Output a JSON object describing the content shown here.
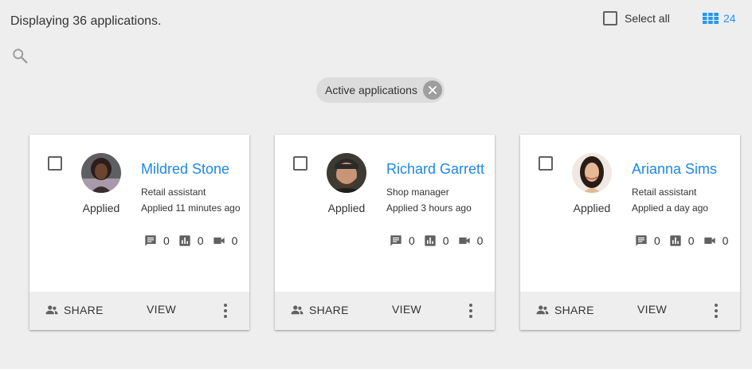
{
  "header": {
    "count_text": "Displaying 36 applications.",
    "select_all_label": "Select all",
    "view_count": "24"
  },
  "filter_chip": {
    "label": "Active applications"
  },
  "colors": {
    "accent": "#1e88e5",
    "background": "#eeeeee",
    "chip": "#dcdcdc"
  },
  "cards": [
    {
      "name": "Mildred Stone",
      "status": "Applied",
      "role": "Retail assistant",
      "applied_time": "Applied 11 minutes ago",
      "stats": {
        "comments": "0",
        "assessments": "0",
        "videos": "0"
      },
      "actions": {
        "share": "SHARE",
        "view": "VIEW"
      }
    },
    {
      "name": "Richard Garrett",
      "status": "Applied",
      "role": "Shop manager",
      "applied_time": "Applied 3 hours ago",
      "stats": {
        "comments": "0",
        "assessments": "0",
        "videos": "0"
      },
      "actions": {
        "share": "SHARE",
        "view": "VIEW"
      }
    },
    {
      "name": "Arianna Sims",
      "status": "Applied",
      "role": "Retail assistant",
      "applied_time": "Applied a day ago",
      "stats": {
        "comments": "0",
        "assessments": "0",
        "videos": "0"
      },
      "actions": {
        "share": "SHARE",
        "view": "VIEW"
      }
    }
  ]
}
